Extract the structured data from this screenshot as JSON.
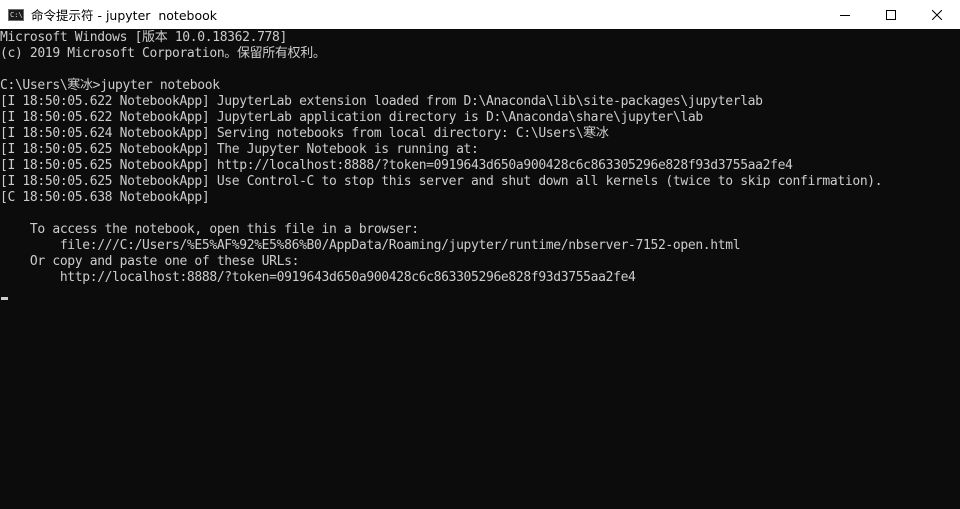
{
  "window": {
    "icon_text": "C:\\",
    "title": "命令提示符 - jupyter  notebook",
    "controls": {
      "minimize_icon": "minimize-icon",
      "maximize_icon": "maximize-icon",
      "close_icon": "close-icon"
    }
  },
  "console": {
    "lines": [
      "Microsoft Windows [版本 10.0.18362.778]",
      "(c) 2019 Microsoft Corporation。保留所有权利。",
      "",
      "C:\\Users\\寒冰>jupyter notebook",
      "[I 18:50:05.622 NotebookApp] JupyterLab extension loaded from D:\\Anaconda\\lib\\site-packages\\jupyterlab",
      "[I 18:50:05.622 NotebookApp] JupyterLab application directory is D:\\Anaconda\\share\\jupyter\\lab",
      "[I 18:50:05.624 NotebookApp] Serving notebooks from local directory: C:\\Users\\寒冰",
      "[I 18:50:05.625 NotebookApp] The Jupyter Notebook is running at:",
      "[I 18:50:05.625 NotebookApp] http://localhost:8888/?token=0919643d650a900428c6c863305296e828f93d3755aa2fe4",
      "[I 18:50:05.625 NotebookApp] Use Control-C to stop this server and shut down all kernels (twice to skip confirmation).",
      "[C 18:50:05.638 NotebookApp]",
      "",
      "    To access the notebook, open this file in a browser:",
      "        file:///C:/Users/%E5%AF%92%E5%86%B0/AppData/Roaming/jupyter/runtime/nbserver-7152-open.html",
      "    Or copy and paste one of these URLs:",
      "        http://localhost:8888/?token=0919643d650a900428c6c863305296e828f93d3755aa2fe4"
    ]
  },
  "colors": {
    "console_bg": "#0c0c0c",
    "console_fg": "#cccccc",
    "titlebar_bg": "#ffffff"
  }
}
